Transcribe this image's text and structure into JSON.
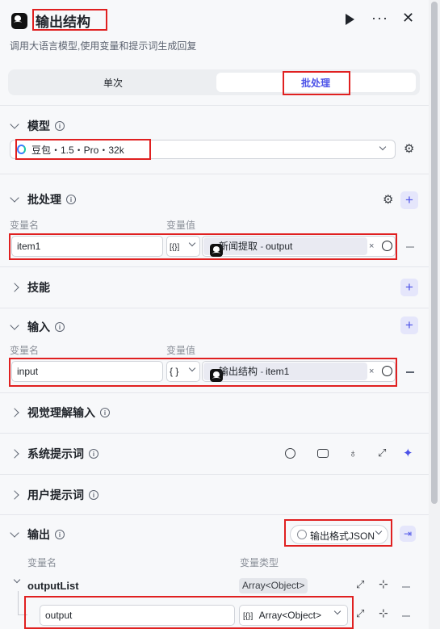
{
  "header": {
    "title": "输出结构",
    "subtitle": "调用大语言模型,使用变量和提示词生成回复"
  },
  "mode_tabs": {
    "single": "单次",
    "batch": "批处理"
  },
  "model_section": {
    "title": "模型",
    "model_name": "豆包・1.5・Pro・32k"
  },
  "batch_section": {
    "title": "批处理",
    "col_name": "变量名",
    "col_value": "变量值",
    "row": {
      "name": "item1",
      "type_icon": "[{}]",
      "ref_node": "新闻提取",
      "ref_sep": " - ",
      "ref_field": "output"
    }
  },
  "skills_section": {
    "title": "技能"
  },
  "input_section": {
    "title": "输入",
    "col_name": "变量名",
    "col_value": "变量值",
    "row": {
      "name": "input",
      "type_icon": "{ }",
      "ref_node": "输出结构",
      "ref_sep": " - ",
      "ref_field": "item1"
    }
  },
  "vision_section": {
    "title": "视觉理解输入"
  },
  "system_prompt_section": {
    "title": "系统提示词"
  },
  "user_prompt_section": {
    "title": "用户提示词"
  },
  "output_section": {
    "title": "输出",
    "format_label": "输出格式JSON",
    "col_name": "变量名",
    "col_type": "变量类型",
    "list_name": "outputList",
    "list_type": "Array<Object>",
    "child_name": "output",
    "child_type_icon": "[{}]",
    "child_type": "Array<Object>"
  },
  "colors": {
    "accent": "#4d53e8",
    "highlight_border": "#e02020",
    "page_bg": "#f7f8fa"
  }
}
